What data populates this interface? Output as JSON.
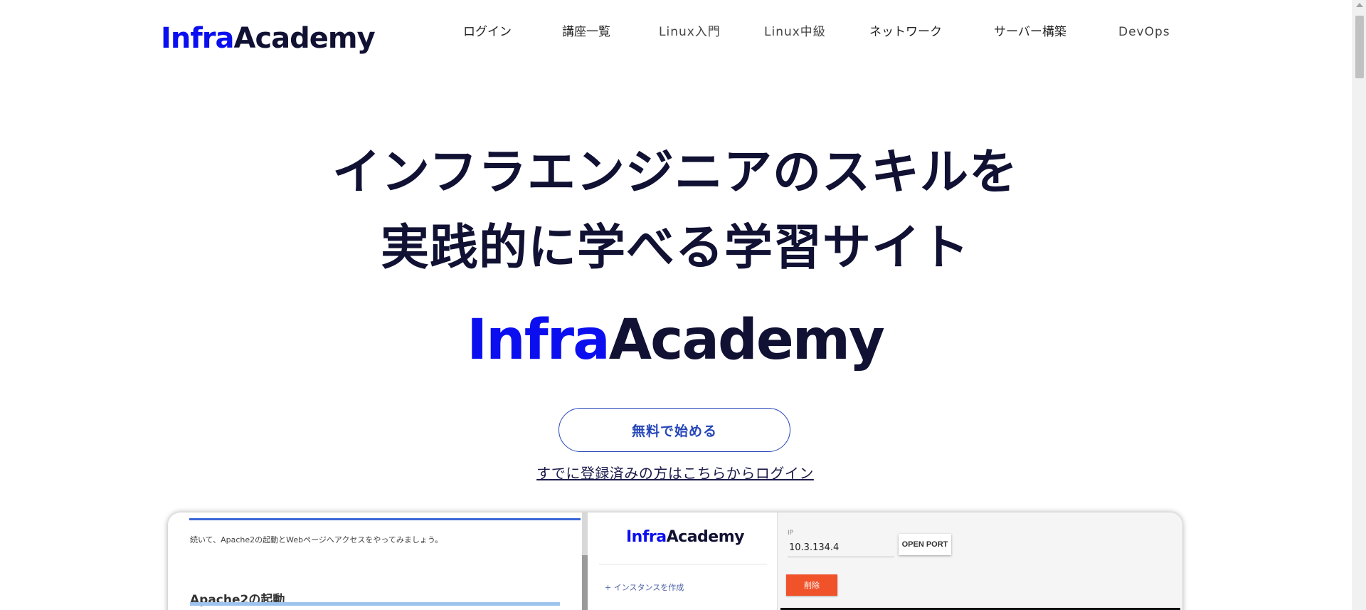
{
  "header": {
    "logo": {
      "part1": "Infra",
      "part2": "Academy"
    },
    "nav": [
      {
        "label": "ログイン"
      },
      {
        "label": "講座一覧"
      },
      {
        "label": "Linux入門"
      },
      {
        "label": "Linux中級"
      },
      {
        "label": "ネットワーク"
      },
      {
        "label": "サーバー構築"
      },
      {
        "label": "DevOps"
      }
    ]
  },
  "hero": {
    "title_line1": "インフラエンジニアのスキルを",
    "title_line2": "実践的に学べる学習サイト",
    "brand": {
      "part1": "Infra",
      "part2": "Academy"
    },
    "cta_label": "無料で始める",
    "login_link": "すでに登録済みの方はこちらからログイン"
  },
  "preview": {
    "lesson_text": "続いて、Apache2の起動とWebページへアクセスをやってみましょう。",
    "lesson_heading": "Apache2の起動",
    "sidebar_logo": {
      "part1": "Infra",
      "part2": "Academy"
    },
    "create_instance": "+ インスタンスを作成",
    "ip_label": "IP",
    "ip_value": "10.3.134.4",
    "open_port_label": "OPEN PORT",
    "delete_label": "削除"
  },
  "colors": {
    "brand_blue": "#0b0ff0",
    "navy": "#101133",
    "cta_border": "#2546b8",
    "delete_button": "#f0522a"
  }
}
